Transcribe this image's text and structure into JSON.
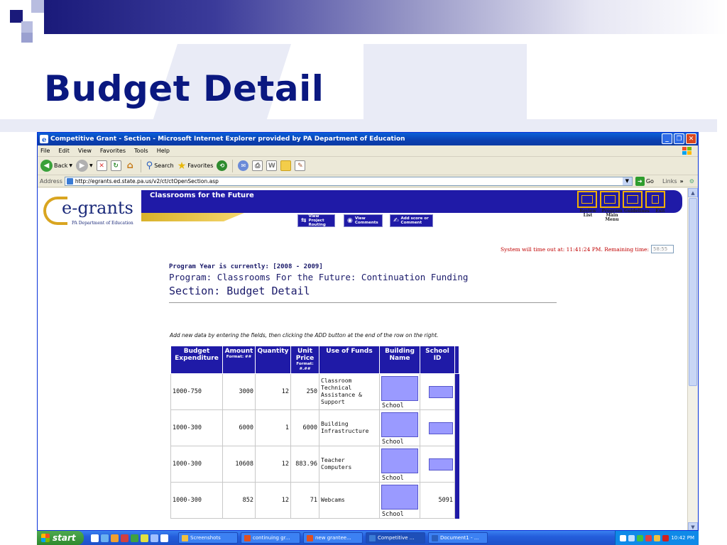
{
  "slide": {
    "title": "Budget Detail"
  },
  "browser": {
    "window_title": "Competitive Grant - Section - Microsoft Internet Explorer provided by PA Department of Education",
    "menu": [
      "File",
      "Edit",
      "View",
      "Favorites",
      "Tools",
      "Help"
    ],
    "toolbar": {
      "back": "Back",
      "search": "Search",
      "favorites": "Favorites"
    },
    "address_label": "Address",
    "address_value": "http://egrants.ed.state.pa.us/v2/ct/ctOpenSection.asp",
    "go_label": "Go",
    "links_label": "Links"
  },
  "page": {
    "logo_text": "e-grants",
    "logo_sub": "PA Department of Education",
    "banner_title": "Classrooms for the Future",
    "actions": {
      "view_routing": "View Project Routing",
      "view_comments": "View Comments",
      "add_score": "Add score or Comment"
    },
    "nav": [
      "Review List",
      "Program Main Menu",
      "Guidelines",
      "Exit"
    ],
    "timeout_text": "System will time out at: 11:41:24 PM. Remaining time:",
    "timeout_remaining": "58:55",
    "program_year": "Program Year is currently: [2008 - 2009]",
    "program_name": "Program: Classrooms For the Future: Continuation Funding",
    "section_name": "Section: Budget Detail",
    "instructions": "Add new data by entering the fields, then clicking the ADD button at the end of the row on the right.",
    "table": {
      "headers": {
        "budget_expenditure": "Budget Expenditure",
        "amount": "Amount",
        "amount_format": "Format: ##",
        "quantity": "Quantity",
        "unit_price": "Unit Price",
        "unit_price_format": "Format: #.##",
        "use_of_funds": "Use of Funds",
        "building_name": "Building Name",
        "school_id": "School ID"
      },
      "rows": [
        {
          "expenditure": "1000-750",
          "amount": "3000",
          "quantity": "12",
          "unit_price": "250",
          "use_of_funds": "Classroom Technical Assistance & Support",
          "building_label": "School",
          "school_id": ""
        },
        {
          "expenditure": "1000-300",
          "amount": "6000",
          "quantity": "1",
          "unit_price": "6000",
          "use_of_funds": "Building Infrastructure",
          "building_label": "School",
          "school_id": ""
        },
        {
          "expenditure": "1000-300",
          "amount": "10608",
          "quantity": "12",
          "unit_price": "883.96",
          "use_of_funds": "Teacher Computers",
          "building_label": "School",
          "school_id": ""
        },
        {
          "expenditure": "1000-300",
          "amount": "852",
          "quantity": "12",
          "unit_price": "71",
          "use_of_funds": "Webcams",
          "building_label": "School",
          "school_id": "5091"
        }
      ]
    }
  },
  "taskbar": {
    "start_label": "start",
    "tasks": [
      "Screenshots",
      "continuing gr...",
      "new grantee...",
      "Competitive ...",
      "Document1 - ..."
    ],
    "clock": "10:42 PM"
  }
}
